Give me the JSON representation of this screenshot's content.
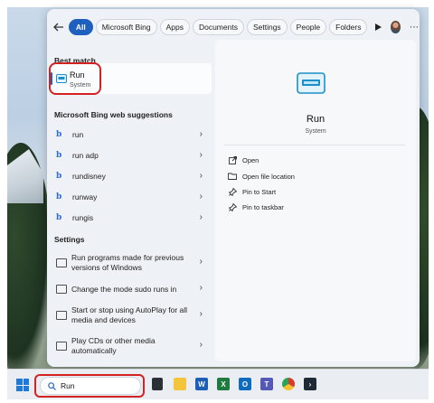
{
  "filters": {
    "items": [
      "All",
      "Microsoft Bing",
      "Apps",
      "Documents",
      "Settings",
      "People",
      "Folders"
    ]
  },
  "best_match": {
    "heading": "Best match",
    "name": "Run",
    "subtitle": "System"
  },
  "web_suggestions": {
    "heading": "Microsoft Bing web suggestions",
    "items": [
      "run",
      "run adp",
      "rundisney",
      "runway",
      "rungis"
    ]
  },
  "settings": {
    "heading": "Settings",
    "items": [
      "Run programs made for previous versions of Windows",
      "Change the mode sudo runs in",
      "Start or stop using AutoPlay for all media and devices",
      "Play CDs or other media automatically"
    ]
  },
  "detail": {
    "name": "Run",
    "subtitle": "System",
    "actions": [
      "Open",
      "Open file location",
      "Pin to Start",
      "Pin to taskbar"
    ]
  },
  "taskbar": {
    "search_value": "Run"
  },
  "colors": {
    "accent": "#1f5fbf",
    "highlight": "#d42121"
  }
}
